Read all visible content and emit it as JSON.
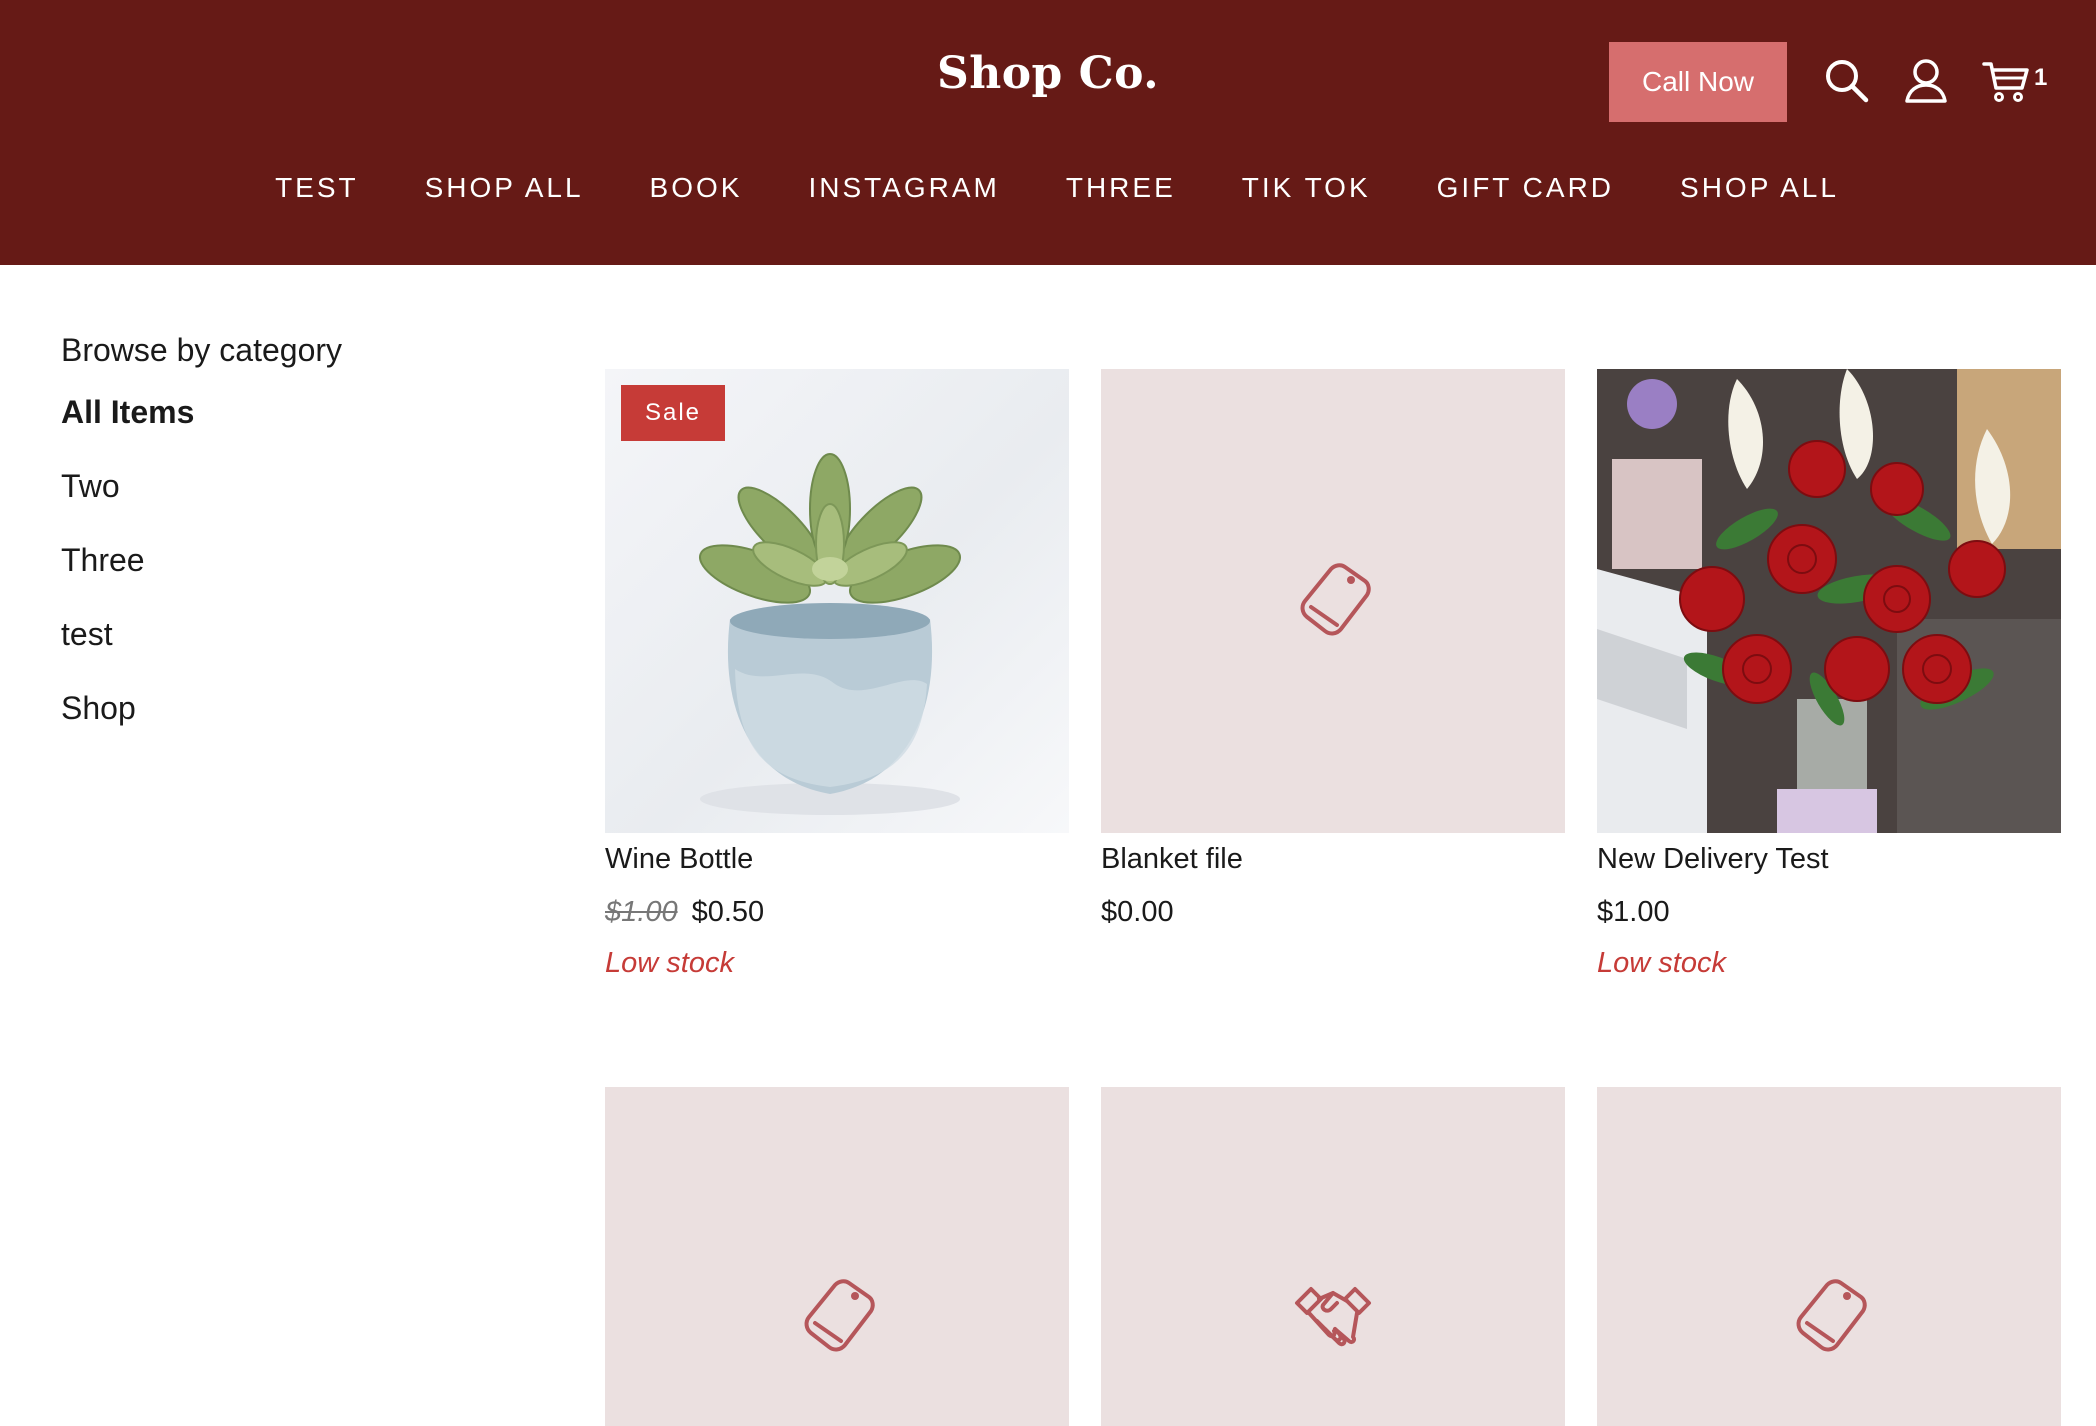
{
  "header": {
    "logo": "Shop Co.",
    "call_button": "Call Now",
    "cart_count": "1",
    "nav": [
      "TEST",
      "SHOP ALL",
      "BOOK",
      "INSTAGRAM",
      "THREE",
      "TIK TOK",
      "GIFT CARD",
      "SHOP ALL"
    ]
  },
  "sidebar": {
    "heading": "Browse by category",
    "categories": [
      "All Items",
      "Two",
      "Three",
      "test",
      "Shop"
    ],
    "active": "All Items"
  },
  "products": [
    {
      "name": "Wine Bottle",
      "badge": "Sale",
      "old_price": "$1.00",
      "price": "$0.50",
      "stock": "Low stock"
    },
    {
      "name": "Blanket file",
      "price": "$0.00"
    },
    {
      "name": "New Delivery Test",
      "price": "$1.00",
      "stock": "Low stock"
    },
    {
      "placeholder": "tag-icon"
    },
    {
      "placeholder": "handshake-icon"
    },
    {
      "placeholder": "tag-icon"
    }
  ],
  "colors": {
    "header_bg": "#661a16",
    "call_button_bg": "#d66e6e",
    "sale_badge": "#c63b37",
    "low_stock": "#c63b37",
    "placeholder_bg": "#ebe0e0",
    "placeholder_icon": "#b5565a"
  }
}
